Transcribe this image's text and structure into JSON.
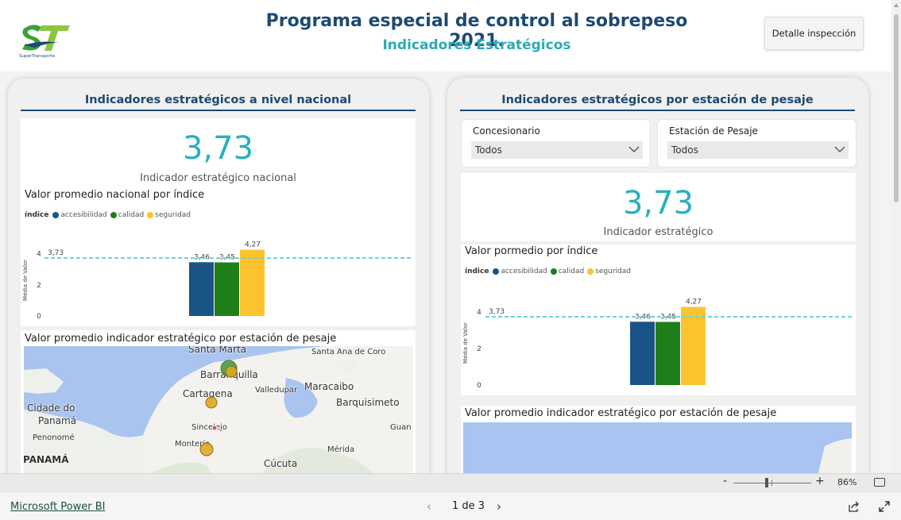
{
  "header": {
    "title": "Programa especial de control al sobrepeso 2021.",
    "subtitle": "Indicadores Estratégicos",
    "logo_text": "SuperTransporte",
    "detail_button": "Detalle inspección"
  },
  "colors": {
    "title": "#1c4a72",
    "subtitle": "#2aaab9",
    "kpi": "#26b1bd",
    "accesibilidad": "#1a5385",
    "calidad": "#1d7e1a",
    "seguridad": "#fcc32e",
    "reference_line": "#6fd3d8"
  },
  "left_panel": {
    "title": "Indicadores estratégicos a nivel nacional",
    "kpi_value": "3,73",
    "kpi_label": "Indicador estratégico nacional",
    "chart_title": "Valor promedio nacional por índice",
    "map_title": "Valor promedio indicador estratégico por estación de pesaje",
    "map_labels": {
      "santa_marta": "Santa Marta",
      "santa_ana": "Santa Ana de Coro",
      "barranquilla": "Barranquilla",
      "cartagena": "Cartagena",
      "valledupar": "Valledupar",
      "maracaibo": "Maracaibo",
      "cidade": "Cidade do",
      "panama": "Panamá",
      "barquisimeto": "Barquisimeto",
      "penonome": "Penonomé",
      "sincelejo": "Sincelejo",
      "guan": "Guan",
      "monteria": "Montería",
      "merida": "Mérida",
      "panama_country": "PANAMÁ",
      "cucuta": "Cúcuta"
    }
  },
  "right_panel": {
    "title": "Indicadores estratégicos por estación de pesaje",
    "slicer_concesionario": {
      "label": "Concesionario",
      "value": "Todos"
    },
    "slicer_estacion": {
      "label": "Estación de Pesaje",
      "value": "Todos"
    },
    "kpi_value": "3,73",
    "kpi_label": "Indicador estratégico",
    "chart_title": "Valor pormedio por índice",
    "map_title": "Valor promedio indicador estratégico por estación de pesaje"
  },
  "chart_data": [
    {
      "type": "bar",
      "title": "Valor promedio nacional por índice",
      "legend_title": "índice",
      "legend_position": "top-left",
      "categories": [
        "accesibilidad",
        "calidad",
        "seguridad"
      ],
      "values": [
        3.46,
        3.45,
        4.27
      ],
      "value_labels": [
        "3,46",
        "3,45",
        "4,27"
      ],
      "ylabel": "Média de Valor",
      "yticks": [
        "0",
        "2",
        "4"
      ],
      "ylim": [
        0,
        4.6
      ],
      "reference_line": {
        "value": 3.73,
        "label": "3,73"
      }
    },
    {
      "type": "bar",
      "title": "Valor pormedio por índice",
      "legend_title": "índice",
      "legend_position": "top-left",
      "categories": [
        "accesibilidad",
        "calidad",
        "seguridad"
      ],
      "values": [
        3.46,
        3.45,
        4.27
      ],
      "value_labels": [
        "3,46",
        "3,45",
        "4,27"
      ],
      "ylabel": "Média de Valor",
      "yticks": [
        "0",
        "2",
        "4"
      ],
      "ylim": [
        0,
        4.6
      ],
      "reference_line": {
        "value": 3.73,
        "label": "3,73"
      }
    }
  ],
  "status_bar": {
    "zoom_minus": "-",
    "zoom_plus": "+",
    "zoom_level": "86%"
  },
  "footer": {
    "brand": "Microsoft Power BI",
    "page_indicator": "1 de 3",
    "prev": "‹",
    "next": "›"
  }
}
